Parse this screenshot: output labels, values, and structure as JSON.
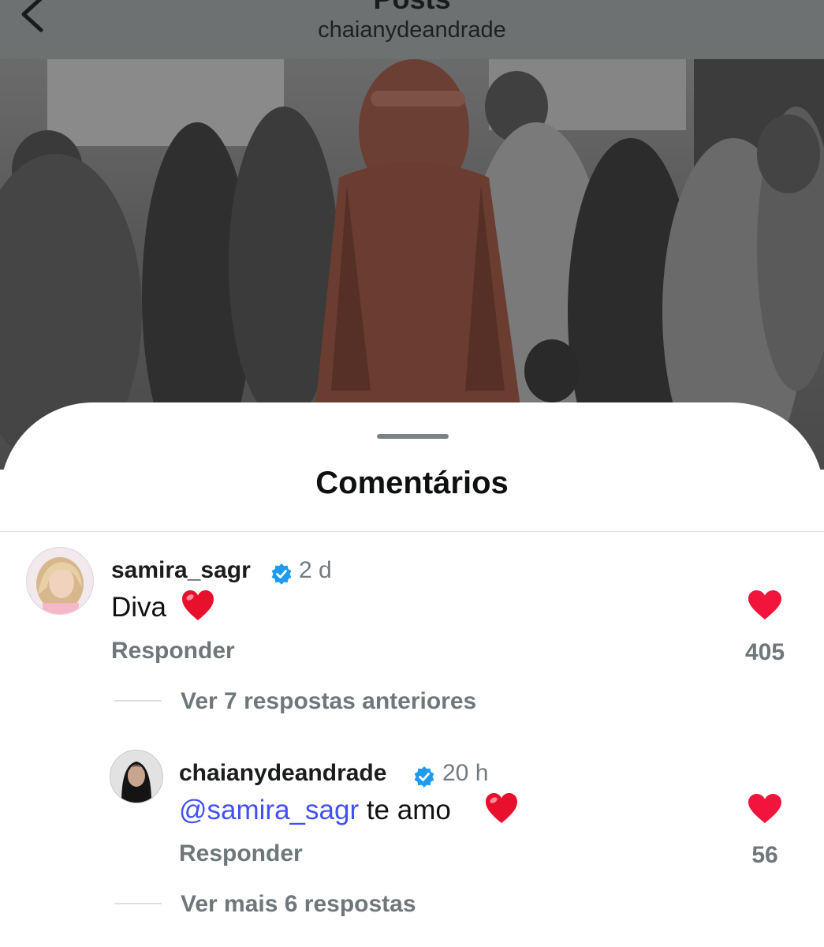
{
  "header": {
    "title": "Posts",
    "subtitle": "chaianydeandrade"
  },
  "comments_sheet": {
    "title": "Comentários"
  },
  "comments": [
    {
      "username": "samira_sagr",
      "verified": true,
      "timestamp": "2 d",
      "text": "Diva",
      "emoji": "red-heart",
      "reply_label": "Responder",
      "likes": "405",
      "view_replies": "Ver 7 respostas anteriores"
    }
  ],
  "replies": [
    {
      "username": "chaianydeandrade",
      "verified": true,
      "timestamp": "20 h",
      "mention": "@samira_sagr",
      "text": " te amo",
      "emoji": "red-heart",
      "reply_label": "Responder",
      "likes": "56",
      "view_more": "Ver mais 6 respostas"
    }
  ],
  "colors": {
    "like_heart": "#f2143c",
    "verified_badge": "#1d9bf0",
    "mention": "#4150f7",
    "muted_text": "#6f777b"
  }
}
